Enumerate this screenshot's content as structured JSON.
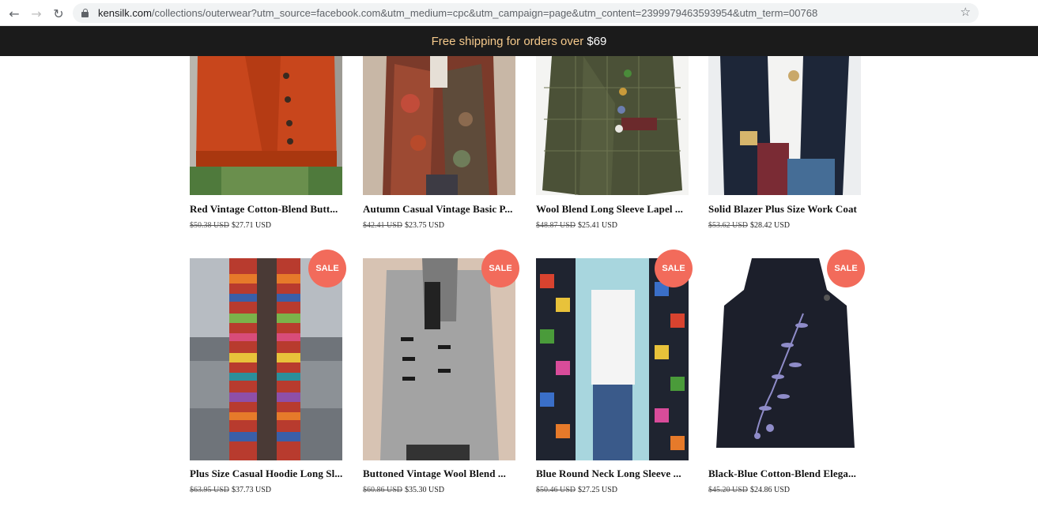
{
  "browser": {
    "url_host": "kensilk.com",
    "url_rest": "/collections/outerwear?utm_source=facebook.com&utm_medium=cpc&utm_campaign=page&utm_content=2399979463593954&utm_term=00768",
    "back_glyph": "←",
    "forward_glyph": "→",
    "reload_glyph": "↻",
    "bookmark_glyph": "☆"
  },
  "announcement": {
    "text": "Free shipping for orders over ",
    "amount": "$69"
  },
  "products": [
    {
      "title": "Red Vintage Cotton-Blend Butt...",
      "old_price": "$50.38 USD",
      "price": "$27.71 USD",
      "sale": ""
    },
    {
      "title": "Autumn Casual Vintage Basic P...",
      "old_price": "$42.41 USD",
      "price": "$23.75 USD",
      "sale": ""
    },
    {
      "title": "Wool Blend Long Sleeve Lapel ...",
      "old_price": "$48.87 USD",
      "price": "$25.41 USD",
      "sale": ""
    },
    {
      "title": "Solid Blazer Plus Size Work Coat",
      "old_price": "$53.62 USD",
      "price": "$28.42 USD",
      "sale": ""
    },
    {
      "title": "Plus Size Casual Hoodie Long Sl...",
      "old_price": "$63.95 USD",
      "price": "$37.73 USD",
      "sale": "SALE"
    },
    {
      "title": "Buttoned Vintage Wool Blend ...",
      "old_price": "$60.86 USD",
      "price": "$35.30 USD",
      "sale": "SALE"
    },
    {
      "title": "Blue Round Neck Long Sleeve ...",
      "old_price": "$50.46 USD",
      "price": "$27.25 USD",
      "sale": "SALE"
    },
    {
      "title": "Black-Blue Cotton-Blend Elega...",
      "old_price": "$45.20 USD",
      "price": "$24.86 USD",
      "sale": "SALE"
    }
  ]
}
